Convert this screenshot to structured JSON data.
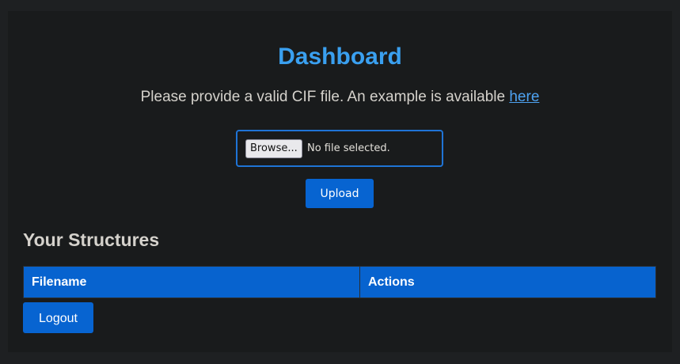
{
  "header": {
    "title": "Dashboard"
  },
  "intro": {
    "text": "Please provide a valid CIF file. An example is available ",
    "link_label": "here"
  },
  "upload_form": {
    "browse_label": "Browse...",
    "file_status": "No file selected.",
    "upload_label": "Upload"
  },
  "structures": {
    "title": "Your Structures",
    "columns": [
      "Filename",
      "Actions"
    ],
    "rows": []
  },
  "footer": {
    "logout_label": "Logout"
  },
  "colors": {
    "accent": "#0764d1",
    "title": "#3aa0f0",
    "background": "#191b1c"
  }
}
